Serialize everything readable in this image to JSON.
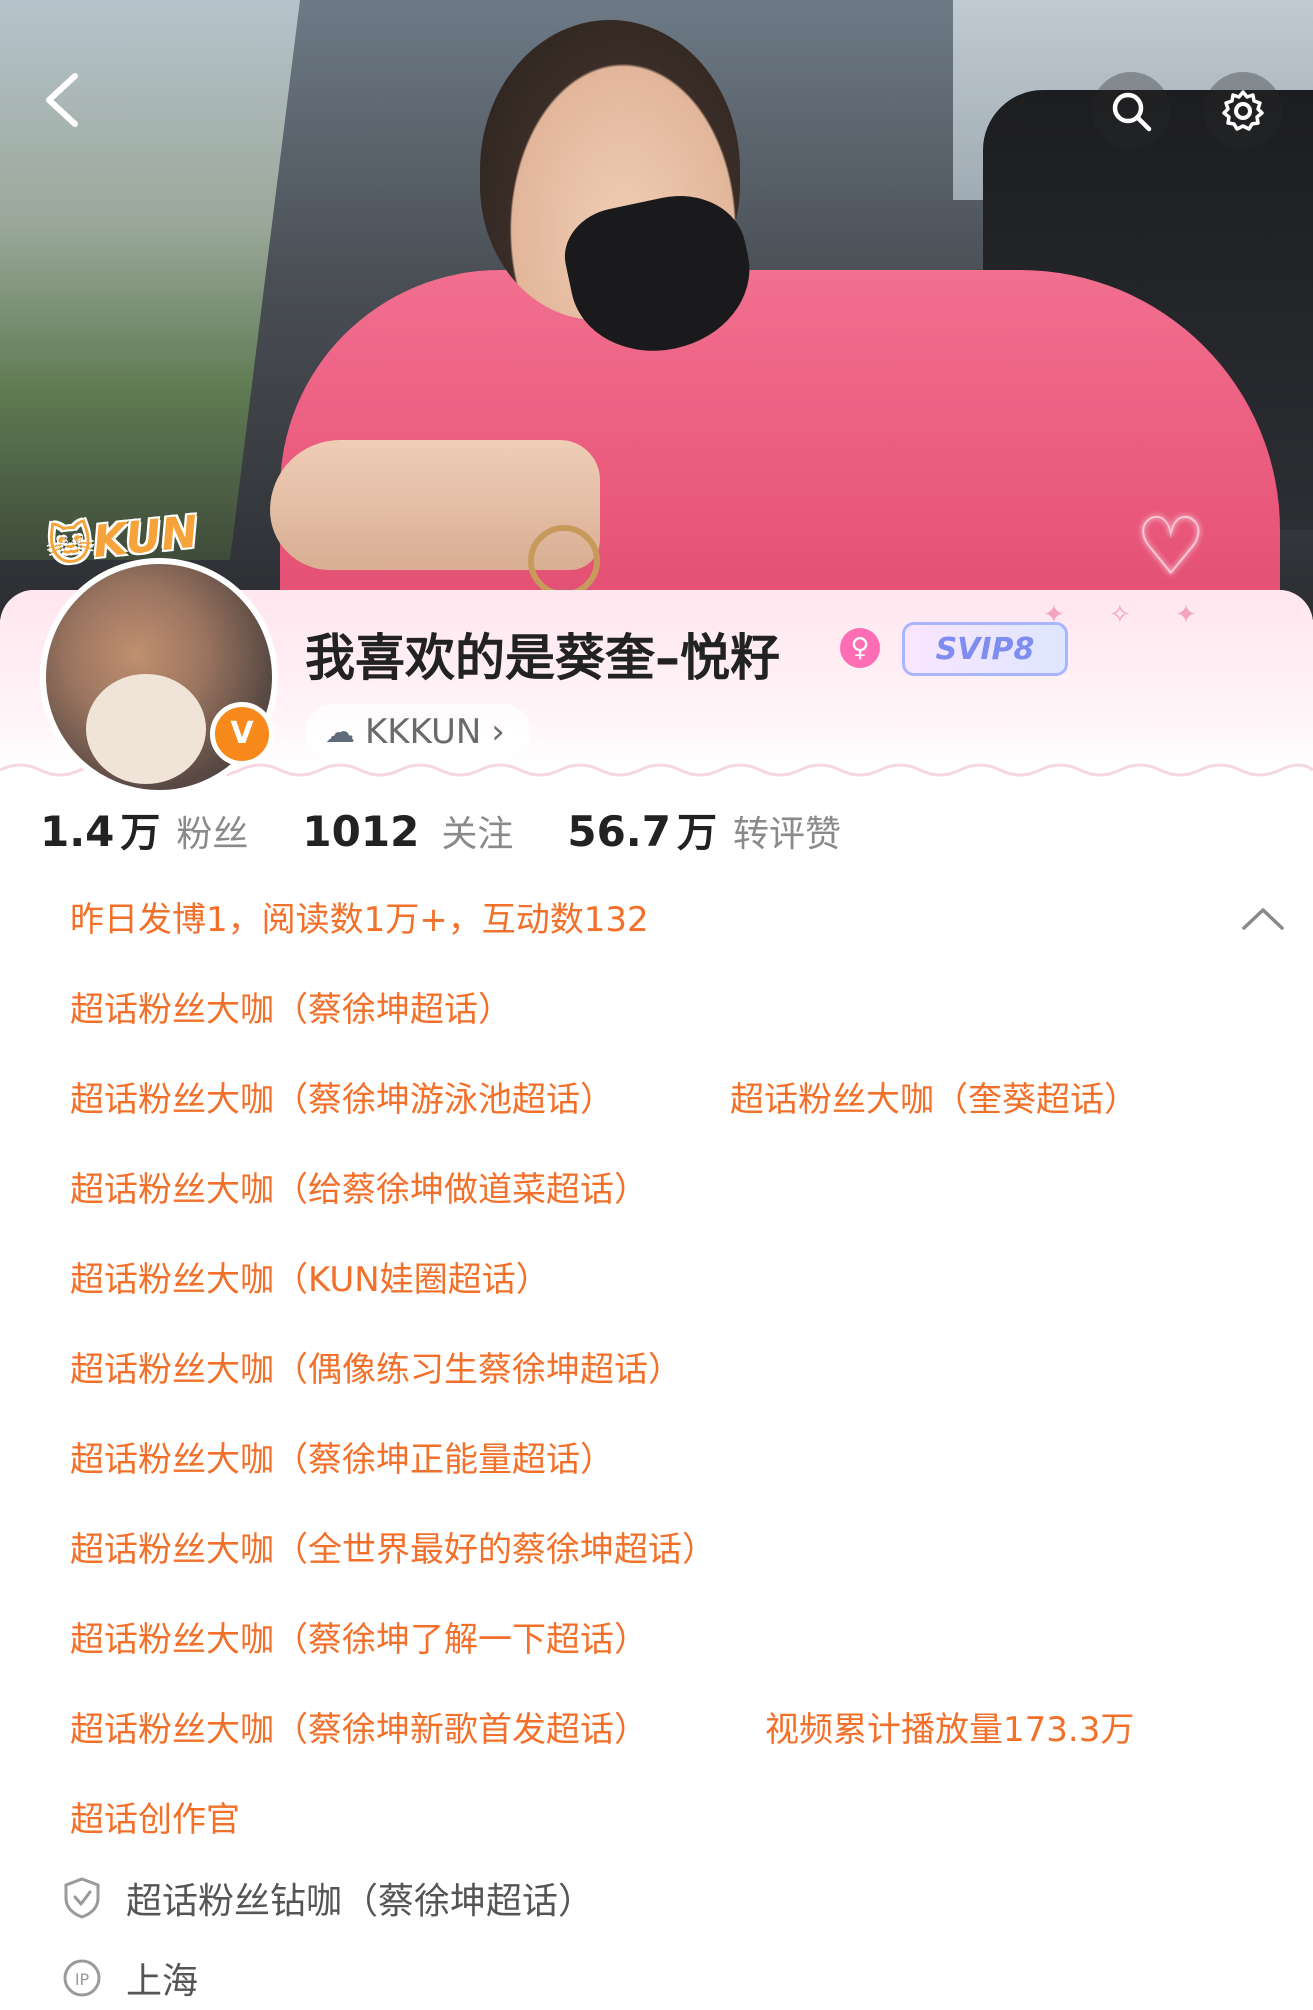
{
  "header": {
    "back_label": "<",
    "search_icon": "search-icon",
    "settings_icon": "gear-icon"
  },
  "profile": {
    "badge_text": "KUN",
    "username": "我喜欢的是葵奎–悦籽",
    "svip_label": "SVIP8",
    "verify_label": "V",
    "group_label": "KKKUN",
    "group_chevron": "›"
  },
  "stats": [
    {
      "num": "1.4",
      "unit": "万",
      "label": "粉丝"
    },
    {
      "num": "1012",
      "unit": "",
      "label": "关注"
    },
    {
      "num": "56.7",
      "unit": "万",
      "label": "转评赞"
    }
  ],
  "info": {
    "summary": "昨日发博1，阅读数1万+，互动数132",
    "lines": [
      "超话粉丝大咖（蔡徐坤超话）",
      "超话粉丝大咖（蔡徐坤游泳池超话）",
      "超话粉丝大咖（给蔡徐坤做道菜超话）",
      "超话粉丝大咖（KUN娃圈超话）",
      "超话粉丝大咖（偶像练习生蔡徐坤超话）",
      "超话粉丝大咖（蔡徐坤正能量超话）",
      "超话粉丝大咖（全世界最好的蔡徐坤超话）",
      "超话粉丝大咖（蔡徐坤了解一下超话）",
      "超话粉丝大咖（蔡徐坤新歌首发超话）",
      "超话创作官"
    ],
    "right_items": [
      "超话粉丝大咖（奎葵超话）",
      "视频累计播放量173.3万"
    ],
    "diamond_line": "超话粉丝钻咖（蔡徐坤超话）",
    "ip_location": "上海"
  },
  "colors": {
    "accent_orange": "#f3702a",
    "verify_orange": "#f88a1c",
    "card_pink": "#ffe6ef"
  }
}
